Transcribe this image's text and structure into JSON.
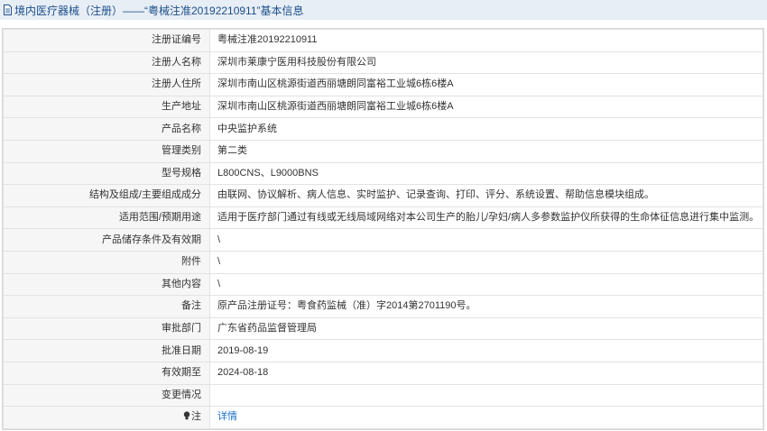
{
  "title": "境内医疗器械（注册）——“粤械注准20192210911”基本信息",
  "rows": [
    {
      "label": "注册证编号",
      "value": "粤械注准20192210911"
    },
    {
      "label": "注册人名称",
      "value": "深圳市莱康宁医用科技股份有限公司"
    },
    {
      "label": "注册人住所",
      "value": "深圳市南山区桃源街道西丽塘朗同富裕工业城6栋6楼A"
    },
    {
      "label": "生产地址",
      "value": "深圳市南山区桃源街道西丽塘朗同富裕工业城6栋6楼A"
    },
    {
      "label": "产品名称",
      "value": "中央监护系统"
    },
    {
      "label": "管理类别",
      "value": "第二类"
    },
    {
      "label": "型号规格",
      "value": "L800CNS、L9000BNS"
    },
    {
      "label": "结构及组成/主要组成成分",
      "value": "由联网、协议解析、病人信息、实时监护、记录查询、打印、评分、系统设置、帮助信息模块组成。"
    },
    {
      "label": "适用范围/预期用途",
      "value": "适用于医疗部门通过有线或无线局域网络对本公司生产的胎儿/孕妇/病人多参数监护仪所获得的生命体征信息进行集中监测。"
    },
    {
      "label": "产品储存条件及有效期",
      "value": "\\"
    },
    {
      "label": "附件",
      "value": "\\"
    },
    {
      "label": "其他内容",
      "value": "\\"
    },
    {
      "label": "备注",
      "value": "原产品注册证号：粤食药监械（准）字2014第2701190号。"
    },
    {
      "label": "审批部门",
      "value": "广东省药品监督管理局"
    },
    {
      "label": "批准日期",
      "value": "2019-08-19"
    },
    {
      "label": "有效期至",
      "value": "2024-08-18"
    },
    {
      "label": "变更情况",
      "value": ""
    }
  ],
  "note": {
    "label": "注",
    "link": "详情"
  },
  "colors": {
    "title_bg": "#e8eef6",
    "title_text": "#1a4e8a",
    "label_bg": "#f6f6f6",
    "link": "#1a6fc9"
  },
  "icons": {
    "title": "document-icon",
    "note": "lightbulb-icon"
  }
}
